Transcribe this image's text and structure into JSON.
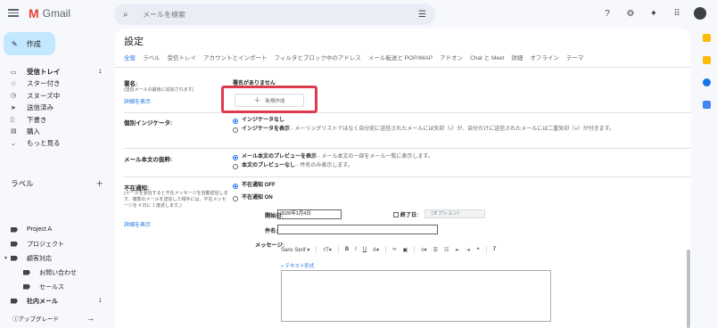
{
  "app": {
    "name": "Gmail"
  },
  "search": {
    "placeholder": "メールを検索"
  },
  "header_icons": [
    "help-icon",
    "settings-icon",
    "gemini-icon",
    "apps-icon",
    "avatar"
  ],
  "compose": {
    "label": "作成"
  },
  "nav": [
    {
      "label": "受信トレイ",
      "count": "1",
      "icon": "inbox-icon",
      "bold": true
    },
    {
      "label": "スター付き",
      "count": "",
      "icon": "star-icon"
    },
    {
      "label": "スヌーズ中",
      "count": "",
      "icon": "clock-icon"
    },
    {
      "label": "送信済み",
      "count": "",
      "icon": "send-icon"
    },
    {
      "label": "下書き",
      "count": "",
      "icon": "draft-icon"
    },
    {
      "label": "購入",
      "count": "",
      "icon": "cart-icon"
    },
    {
      "label": "もっと見る",
      "count": "",
      "icon": "chevron-down-icon"
    }
  ],
  "labels": {
    "heading": "ラベル",
    "items": [
      {
        "label": "Project A",
        "count": ""
      },
      {
        "label": "プロジェクト",
        "count": ""
      },
      {
        "label": "顧客対応",
        "count": ""
      },
      {
        "label": "お問い合わせ",
        "count": ""
      },
      {
        "label": "セールス",
        "count": ""
      },
      {
        "label": "社内メール",
        "count": "1"
      }
    ]
  },
  "upgrade": {
    "label": "アップグレード"
  },
  "settings": {
    "title": "設定",
    "tabs": [
      "全般",
      "ラベル",
      "受信トレイ",
      "アカウントとインポート",
      "フィルタとブロック中のアドレス",
      "メール転送と POP/IMAP",
      "アドオン",
      "Chat と Meet",
      "詳細",
      "オフライン",
      "テーマ"
    ],
    "signature": {
      "label": "署名:",
      "note": "(送信メールの最後に追加されます)",
      "link": "詳細を表示",
      "none_text": "署名がありません",
      "new_button": "新規作成"
    },
    "personal_indicators": {
      "label": "個別インジケータ:",
      "options": [
        {
          "title": "インジケータなし",
          "desc": "",
          "selected": true
        },
        {
          "title": "インジケータを表示",
          "desc": " - メーリングリストではなく自分宛に送信されたメールには矢印（›）が、自分だけに送信されたメールには二重矢印（»）が付きます。",
          "selected": false
        }
      ]
    },
    "snippets": {
      "label": "メール本文の抜粋:",
      "options": [
        {
          "title": "メール本文のプレビューを表示",
          "desc": " - メール本文の一部をメール一覧に表示します。",
          "selected": true
        },
        {
          "title": "本文のプレビューなし",
          "desc": " - 件名のみ表示します。",
          "selected": false
        }
      ]
    },
    "vacation": {
      "label": "不在通知:",
      "note": "(メールを受信すると不在メッセージを自動返信します。複数のメールを送信した相手には、不在メッセージを 4 日に 1 度返します。)",
      "link": "詳細を表示",
      "off_label": "不在通知 OFF",
      "on_label": "不在通知 ON",
      "start_label": "開始日:",
      "start_value": "2026年1月4日",
      "end_label": "終了日:",
      "end_placeholder": "（オプション）",
      "subject_label": "件名:",
      "message_label": "メッセージ:",
      "font": "Sans Serif",
      "rich_text_link": "« テキスト形式"
    }
  },
  "colors": {
    "accent": "#1a73e8",
    "compose_bg": "#c2e7ff",
    "highlight_box": "#db3b4b"
  }
}
